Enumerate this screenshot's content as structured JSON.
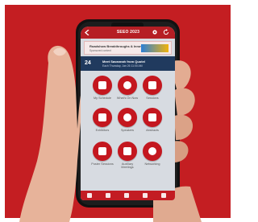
{
  "app": {
    "title": "SEEO 2023",
    "banner": {
      "line1": "Roadshow Breakthroughs & Innovations",
      "line2": "Sponsored content"
    },
    "info": {
      "count": "24",
      "line1": "Meet Savannah from Quotel",
      "line2": "Each Thursday, Jan 26 11:00 AM"
    },
    "tiles": [
      {
        "label": "My Schedule",
        "icon": "calendar-icon"
      },
      {
        "label": "What's On Now",
        "icon": "clock-icon"
      },
      {
        "label": "Sessions",
        "icon": "sessions-icon"
      },
      {
        "label": "Exhibitors",
        "icon": "storefront-icon"
      },
      {
        "label": "Speakers",
        "icon": "speaker-icon"
      },
      {
        "label": "Abstracts",
        "icon": "document-icon"
      },
      {
        "label": "Poster Sessions",
        "icon": "poster-icon"
      },
      {
        "label": "Auxiliary Meetings",
        "icon": "camera-icon"
      },
      {
        "label": "Networking",
        "icon": "people-icon"
      }
    ],
    "bottom_icons": [
      "home-icon",
      "menu-icon",
      "plus-icon",
      "calendar-icon",
      "search-icon"
    ]
  },
  "colors": {
    "background_red": "#c41e22",
    "topbar": "#b61e24",
    "tile": "#c4171f",
    "infobar": "#203a5e"
  }
}
